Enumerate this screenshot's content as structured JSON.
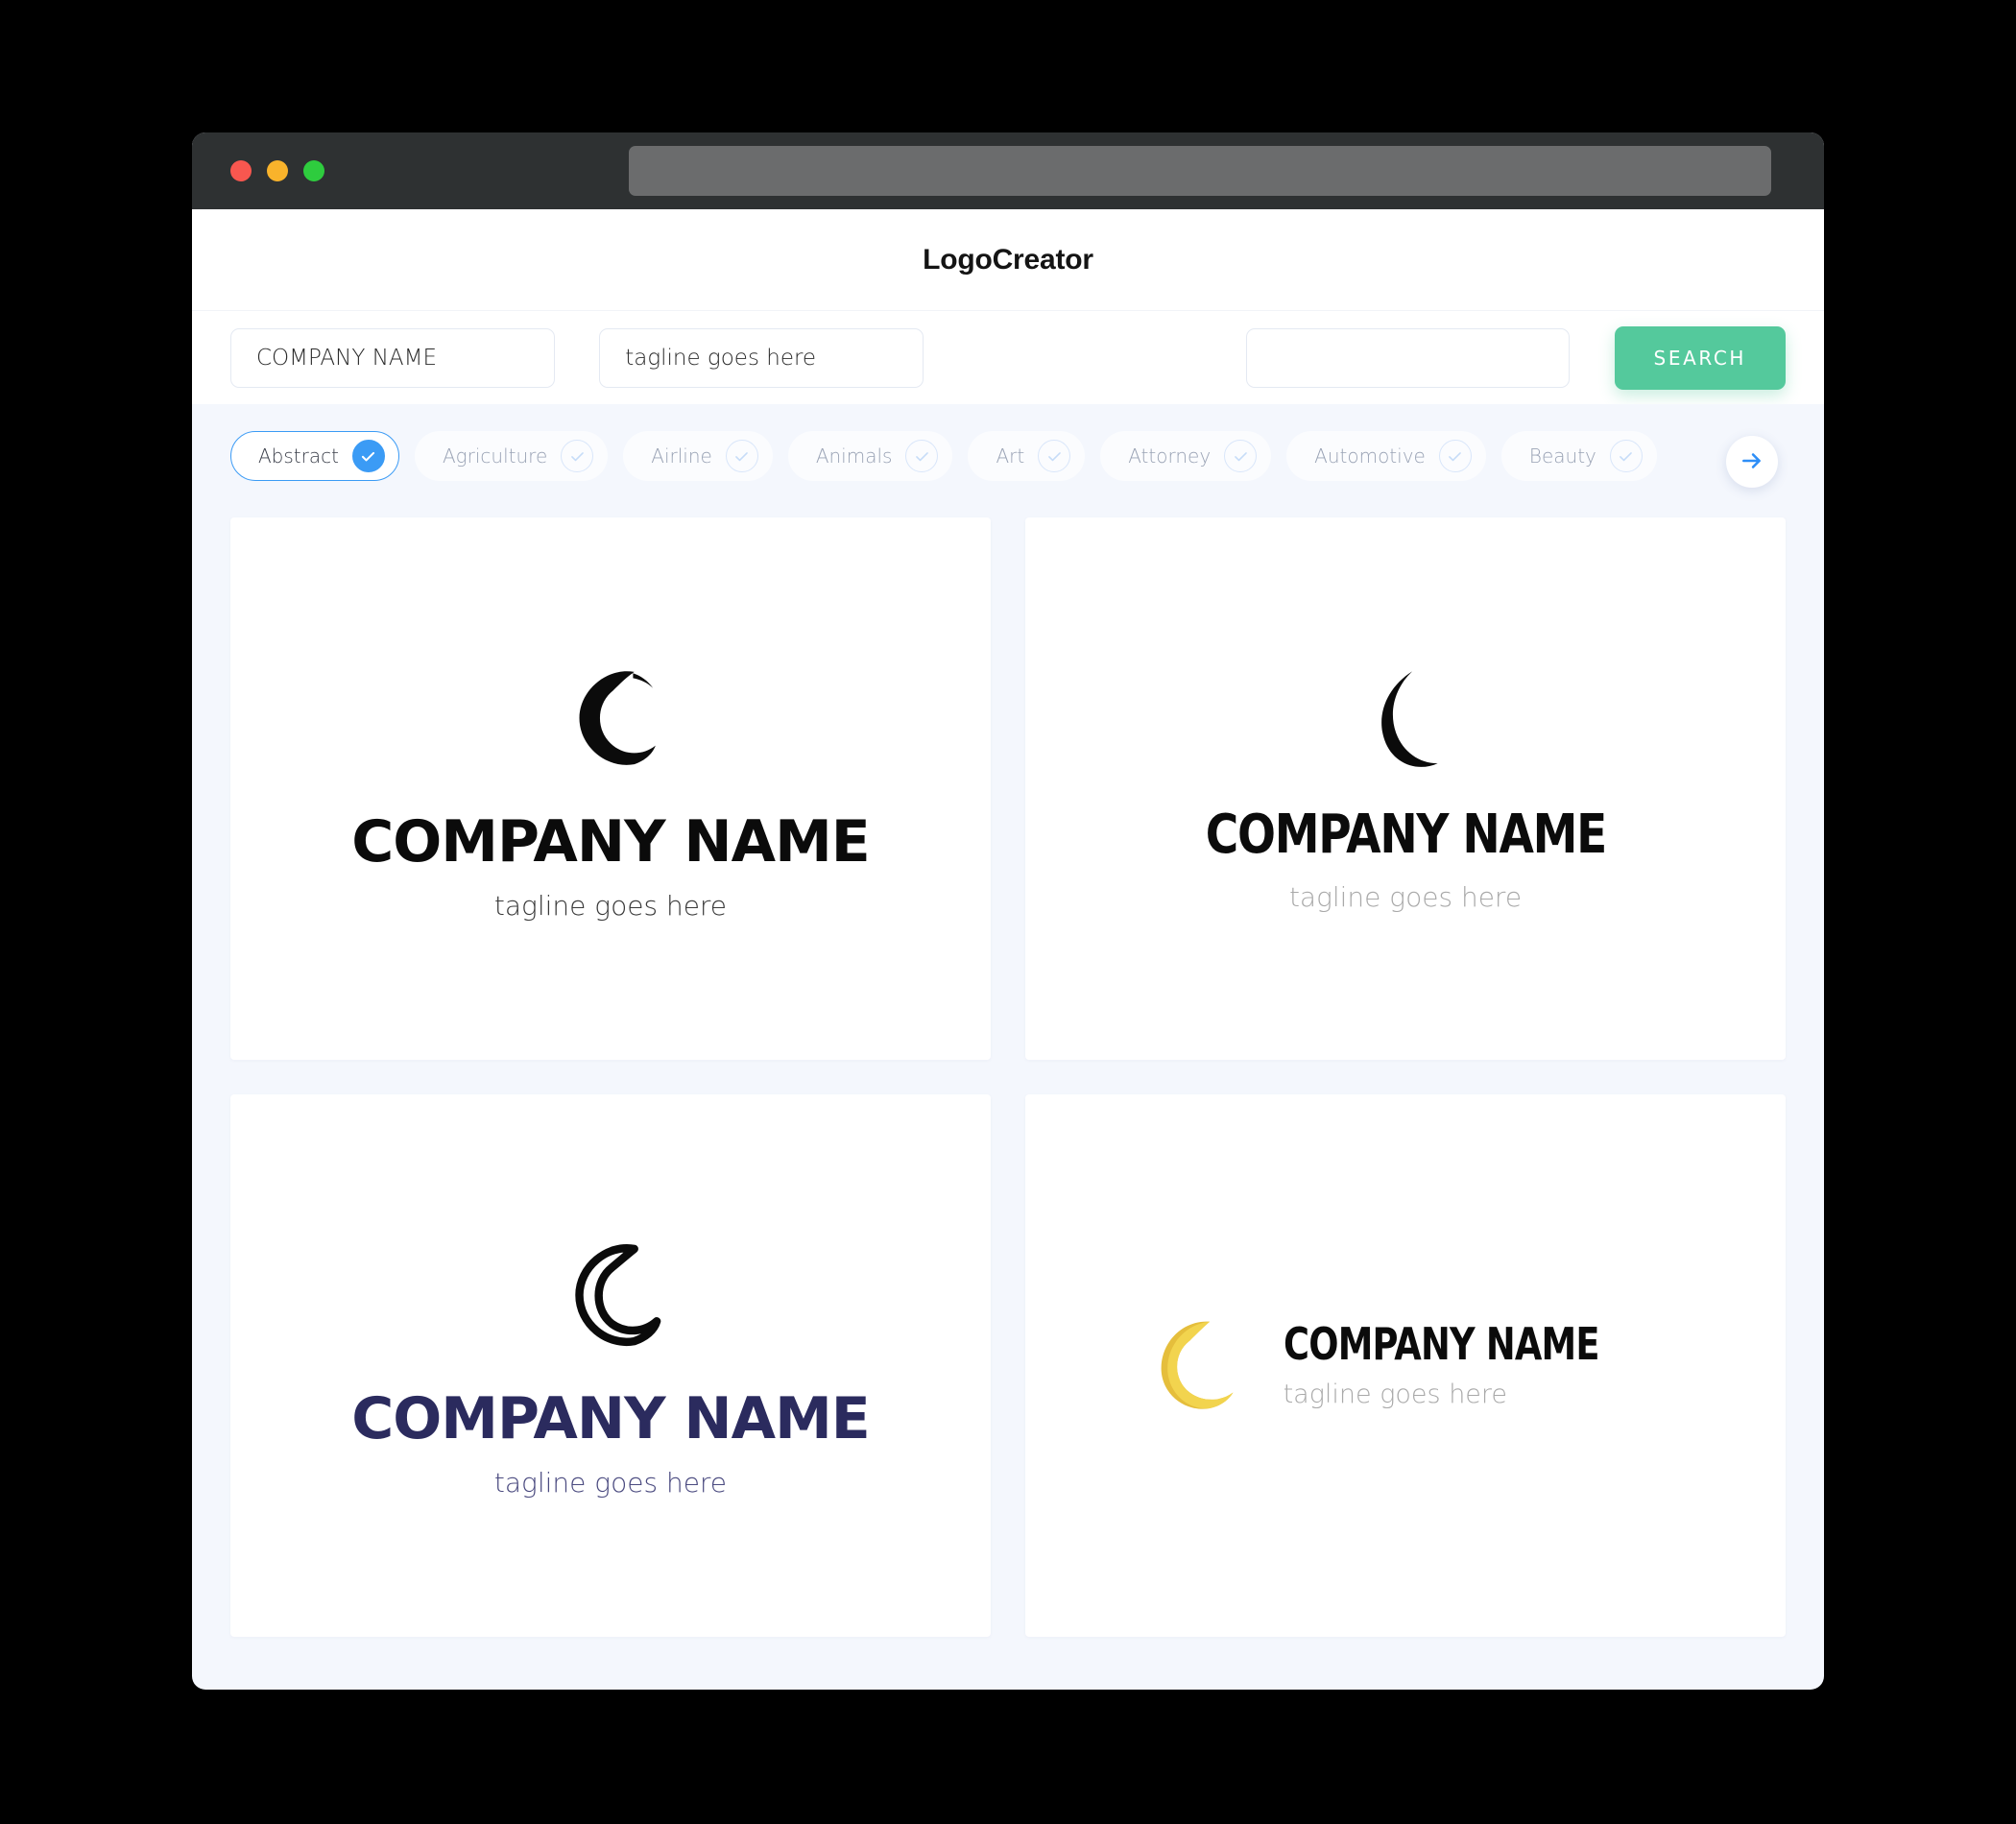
{
  "window": {
    "titlebar": {
      "buttons": [
        {
          "name": "close-button",
          "color": "#F8574F"
        },
        {
          "name": "minimize-button",
          "color": "#F9B32B"
        },
        {
          "name": "maximize-button",
          "color": "#2ECC3E"
        }
      ],
      "address_bar_value": ""
    }
  },
  "header": {
    "title": "LogoCreator"
  },
  "search": {
    "company_name_value": "COMPANY NAME",
    "company_name_placeholder": "COMPANY NAME",
    "tagline_value": "tagline goes here",
    "tagline_placeholder": "tagline goes here",
    "third_value": "",
    "third_placeholder": "",
    "search_button_label": "SEARCH",
    "search_button_color": "#54C99C"
  },
  "categories": {
    "selected": "Abstract",
    "accent_color": "#3B9BF5",
    "items": [
      {
        "label": "Abstract",
        "selected": true
      },
      {
        "label": "Agriculture",
        "selected": false
      },
      {
        "label": "Airline",
        "selected": false
      },
      {
        "label": "Animals",
        "selected": false
      },
      {
        "label": "Art",
        "selected": false
      },
      {
        "label": "Attorney",
        "selected": false
      },
      {
        "label": "Automotive",
        "selected": false
      },
      {
        "label": "Beauty",
        "selected": false
      }
    ],
    "next_icon": "arrow-right-icon"
  },
  "results": {
    "cards": [
      {
        "icon": "crescent-moon-filled-icon",
        "name": "COMPANY NAME",
        "tagline": "tagline goes here",
        "name_color": "#0B0B0B",
        "tagline_color": "#3A3A3A",
        "icon_color": "#0B0B0B",
        "layout": "vertical"
      },
      {
        "icon": "crescent-moon-thin-icon",
        "name": "COMPANY NAME",
        "tagline": "tagline goes here",
        "name_color": "#0B0B0B",
        "tagline_color": "#A9A9A9",
        "icon_color": "#0B0B0B",
        "layout": "vertical"
      },
      {
        "icon": "crescent-moon-outline-icon",
        "name": "COMPANY NAME",
        "tagline": "tagline goes here",
        "name_color": "#2B2B5E",
        "tagline_color": "#4B4B80",
        "icon_color": "#0B0B0B",
        "layout": "vertical"
      },
      {
        "icon": "crescent-moon-yellow-icon",
        "name": "COMPANY NAME",
        "tagline": "tagline goes here",
        "name_color": "#0B0B0B",
        "tagline_color": "#A9A9A9",
        "icon_color": "#F2D44E",
        "icon_shadow_color": "#E5BE3C",
        "layout": "horizontal"
      }
    ]
  }
}
